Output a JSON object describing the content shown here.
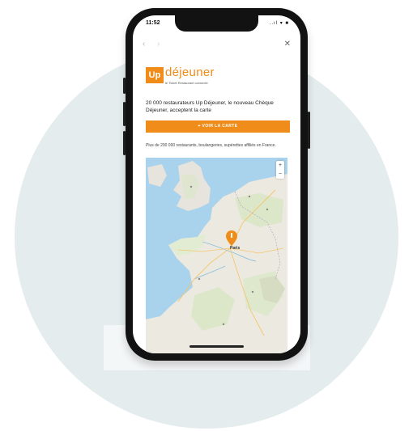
{
  "status_bar": {
    "time": "11:52",
    "icons": "..ıl ▾ ■"
  },
  "browser": {
    "back_icon": "chevron-left-icon",
    "forward_icon": "chevron-right-icon",
    "close_icon": "close-icon"
  },
  "brand": {
    "logo_mark": "Up",
    "logo_word": "déjeuner",
    "logo_tagline": "le Ticket Restaurant connecté",
    "accent_color": "#f08c1a"
  },
  "content": {
    "intro": "20 000 restaurateurs Up Déjeuner, le nouveau Chèque Déjeuner, acceptent la carte",
    "cta_label": "⌖ VOIR LA CARTE",
    "note": "Plus de 200 000 restaurants, boulangeries, supérettes affiliés en France."
  },
  "map": {
    "city_label": "Paris",
    "zoom_in": "+",
    "zoom_out": "−"
  }
}
